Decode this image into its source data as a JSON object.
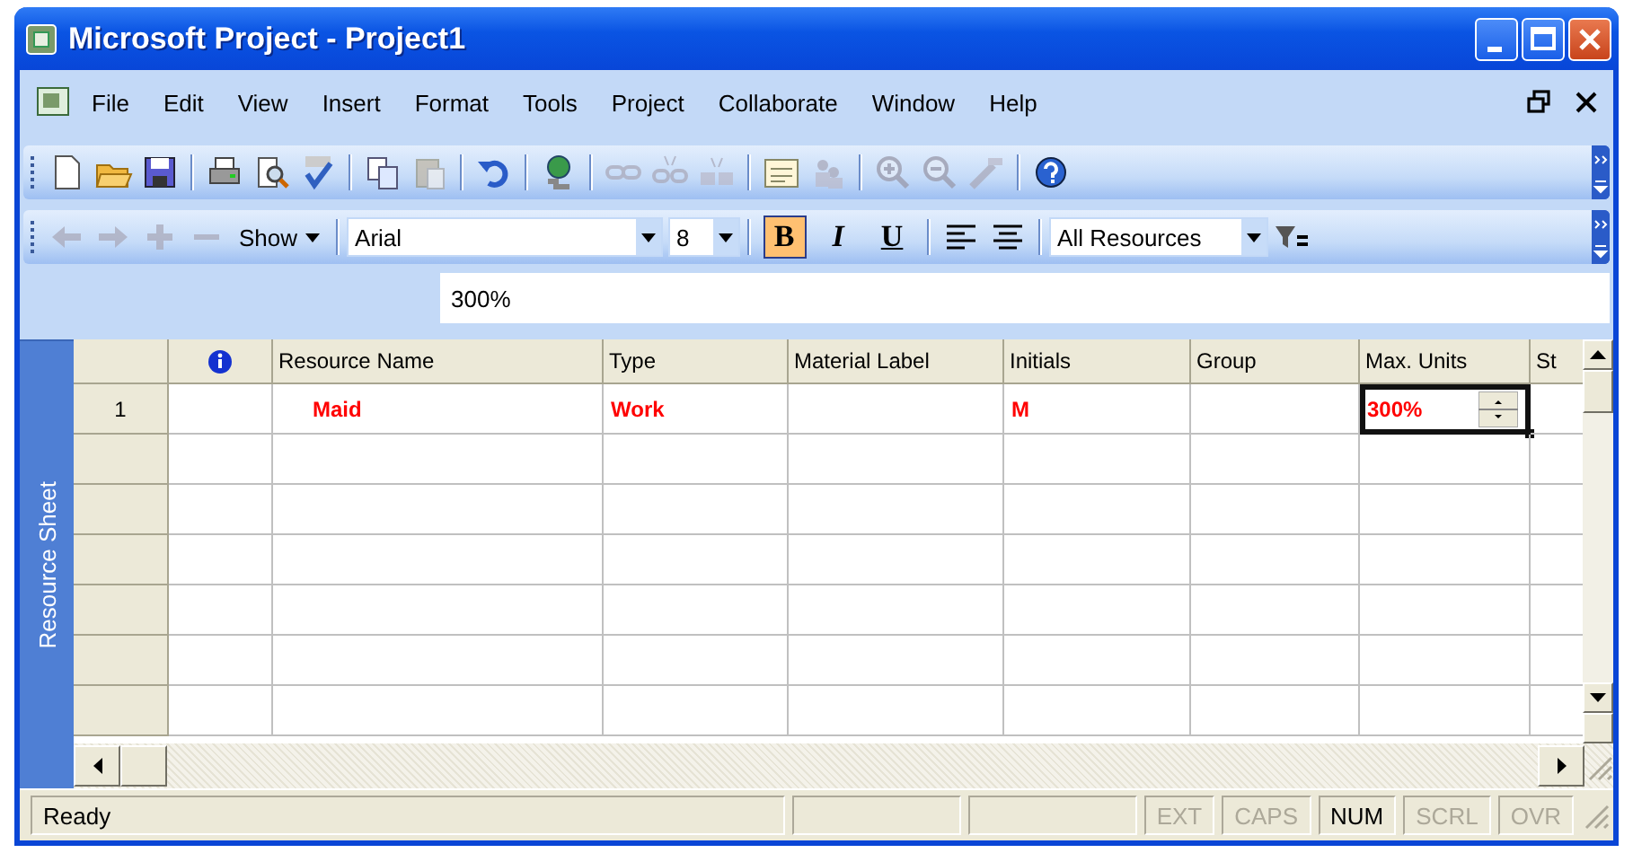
{
  "window": {
    "title": "Microsoft Project - Project1"
  },
  "menu": [
    {
      "label": "File"
    },
    {
      "label": "Edit"
    },
    {
      "label": "View"
    },
    {
      "label": "Insert"
    },
    {
      "label": "Format"
    },
    {
      "label": "Tools"
    },
    {
      "label": "Project"
    },
    {
      "label": "Collaborate"
    },
    {
      "label": "Window"
    },
    {
      "label": "Help"
    }
  ],
  "standard_toolbar": [
    {
      "kind": "new",
      "disabled": false
    },
    {
      "kind": "open",
      "disabled": false
    },
    {
      "kind": "save",
      "disabled": false
    },
    {
      "kind": "separator"
    },
    {
      "kind": "print",
      "disabled": false
    },
    {
      "kind": "preview",
      "disabled": false
    },
    {
      "kind": "spelling",
      "disabled": false
    },
    {
      "kind": "separator"
    },
    {
      "kind": "copy",
      "disabled": false
    },
    {
      "kind": "paste",
      "disabled": true
    },
    {
      "kind": "separator"
    },
    {
      "kind": "undo",
      "disabled": false
    },
    {
      "kind": "separator"
    },
    {
      "kind": "hyperlink",
      "disabled": false
    },
    {
      "kind": "separator"
    },
    {
      "kind": "link",
      "disabled": true
    },
    {
      "kind": "unlink",
      "disabled": true
    },
    {
      "kind": "split",
      "disabled": true
    },
    {
      "kind": "separator"
    },
    {
      "kind": "notes",
      "disabled": false
    },
    {
      "kind": "assign",
      "disabled": true
    },
    {
      "kind": "separator"
    },
    {
      "kind": "zoom_in",
      "disabled": true
    },
    {
      "kind": "zoom_out",
      "disabled": true
    },
    {
      "kind": "wizard",
      "disabled": true
    },
    {
      "kind": "separator"
    },
    {
      "kind": "help",
      "disabled": false
    }
  ],
  "formatting_toolbar": [
    {
      "kind": "back",
      "disabled": true
    },
    {
      "kind": "forward",
      "disabled": true
    },
    {
      "kind": "plus",
      "disabled": true
    },
    {
      "kind": "minus",
      "disabled": true
    },
    {
      "kind": "menu",
      "label": "Show"
    },
    {
      "kind": "separator"
    },
    {
      "kind": "font",
      "value": "Arial"
    },
    {
      "kind": "size",
      "value": "8"
    },
    {
      "kind": "separator"
    },
    {
      "kind": "bold",
      "label": "B",
      "on": true
    },
    {
      "kind": "italic",
      "label": "I",
      "on": false
    },
    {
      "kind": "underline",
      "label": "U",
      "on": false
    },
    {
      "kind": "separator"
    },
    {
      "kind": "align_left",
      "disabled": false
    },
    {
      "kind": "align_center",
      "disabled": false
    },
    {
      "kind": "separator"
    },
    {
      "kind": "filter",
      "value": "All Resources"
    },
    {
      "kind": "autofilter",
      "disabled": false
    }
  ],
  "entry_bar": {
    "value": "300%"
  },
  "view_bar": {
    "label": "Resource Sheet"
  },
  "table": {
    "columns": [
      {
        "kind": "row_number"
      },
      {
        "kind": "indicators"
      },
      {
        "kind": "text",
        "label": "Resource Name"
      },
      {
        "kind": "text",
        "label": "Type"
      },
      {
        "kind": "text",
        "label": "Material Label"
      },
      {
        "kind": "text",
        "label": "Initials"
      },
      {
        "kind": "text",
        "label": "Group"
      },
      {
        "kind": "text",
        "label": "Max. Units"
      },
      {
        "kind": "text",
        "label": "St"
      }
    ],
    "rows": [
      {
        "overallocated": true,
        "cells": [
          {
            "text": "1",
            "editing": false
          },
          {
            "editing": false
          },
          {
            "text": "Maid",
            "editing": false
          },
          {
            "text": "Work",
            "editing": false
          },
          {
            "editing": false
          },
          {
            "text": "M",
            "editing": false
          },
          {
            "editing": false
          },
          {
            "text": "300%",
            "editing": true
          },
          {
            "editing": false
          }
        ]
      }
    ]
  },
  "status_bar": {
    "message": "Ready",
    "indicators": [
      {
        "label": "EXT",
        "on": false
      },
      {
        "label": "CAPS",
        "on": false
      },
      {
        "label": "NUM",
        "on": true
      },
      {
        "label": "SCRL",
        "on": false
      },
      {
        "label": "OVR",
        "on": false
      }
    ]
  }
}
